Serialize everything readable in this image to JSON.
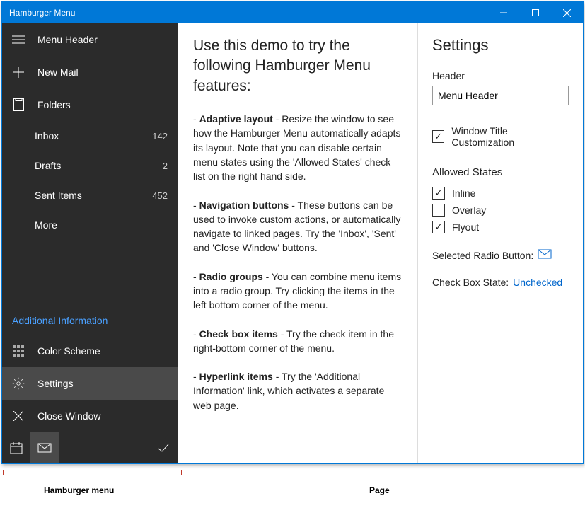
{
  "window": {
    "title": "Hamburger Menu"
  },
  "sidebar": {
    "header": "Menu Header",
    "new_mail": "New Mail",
    "folders_label": "Folders",
    "folders": [
      {
        "label": "Inbox",
        "count": "142"
      },
      {
        "label": "Drafts",
        "count": "2"
      },
      {
        "label": "Sent Items",
        "count": "452"
      },
      {
        "label": "More",
        "count": ""
      }
    ],
    "additional_info": "Additional Information",
    "bottom": [
      {
        "name": "color-scheme",
        "label": "Color Scheme"
      },
      {
        "name": "settings",
        "label": "Settings",
        "selected": true
      },
      {
        "name": "close-window",
        "label": "Close Window"
      }
    ],
    "radio_icons": [
      "calendar-icon",
      "mail-icon"
    ]
  },
  "main": {
    "heading": "Use this demo to try the following Hamburger Menu features:",
    "items": [
      {
        "bold": "Adaptive layout",
        "text": " - Resize the window to see how the Hamburger Menu automatically adapts its layout. Note that you can disable certain menu states using the 'Allowed States' check list on the right hand side."
      },
      {
        "bold": "Navigation buttons",
        "text": " - These buttons can be used to invoke custom actions, or automatically navigate to linked pages. Try the 'Inbox', 'Sent' and 'Close Window' buttons."
      },
      {
        "bold": "Radio groups",
        "text": " - You can combine menu items into a radio group. Try clicking the items in the left bottom corner of the menu."
      },
      {
        "bold": "Check box items",
        "text": " - Try the check item in the right-bottom corner of the menu."
      },
      {
        "bold": "Hyperlink items",
        "text": " - Try the 'Additional Information' link, which activates a separate web page."
      }
    ]
  },
  "settings": {
    "title": "Settings",
    "header_label": "Header",
    "header_value": "Menu Header",
    "window_title_custom": {
      "label": "Window Title Customization",
      "checked": true
    },
    "allowed_states_label": "Allowed States",
    "allowed_states": [
      {
        "label": "Inline",
        "checked": true
      },
      {
        "label": "Overlay",
        "checked": false
      },
      {
        "label": "Flyout",
        "checked": true
      }
    ],
    "selected_radio_label": "Selected Radio Button:",
    "checkbox_state_label": "Check Box State:",
    "checkbox_state_value": "Unchecked"
  },
  "diagram": {
    "left": "Hamburger menu",
    "right": "Page"
  }
}
